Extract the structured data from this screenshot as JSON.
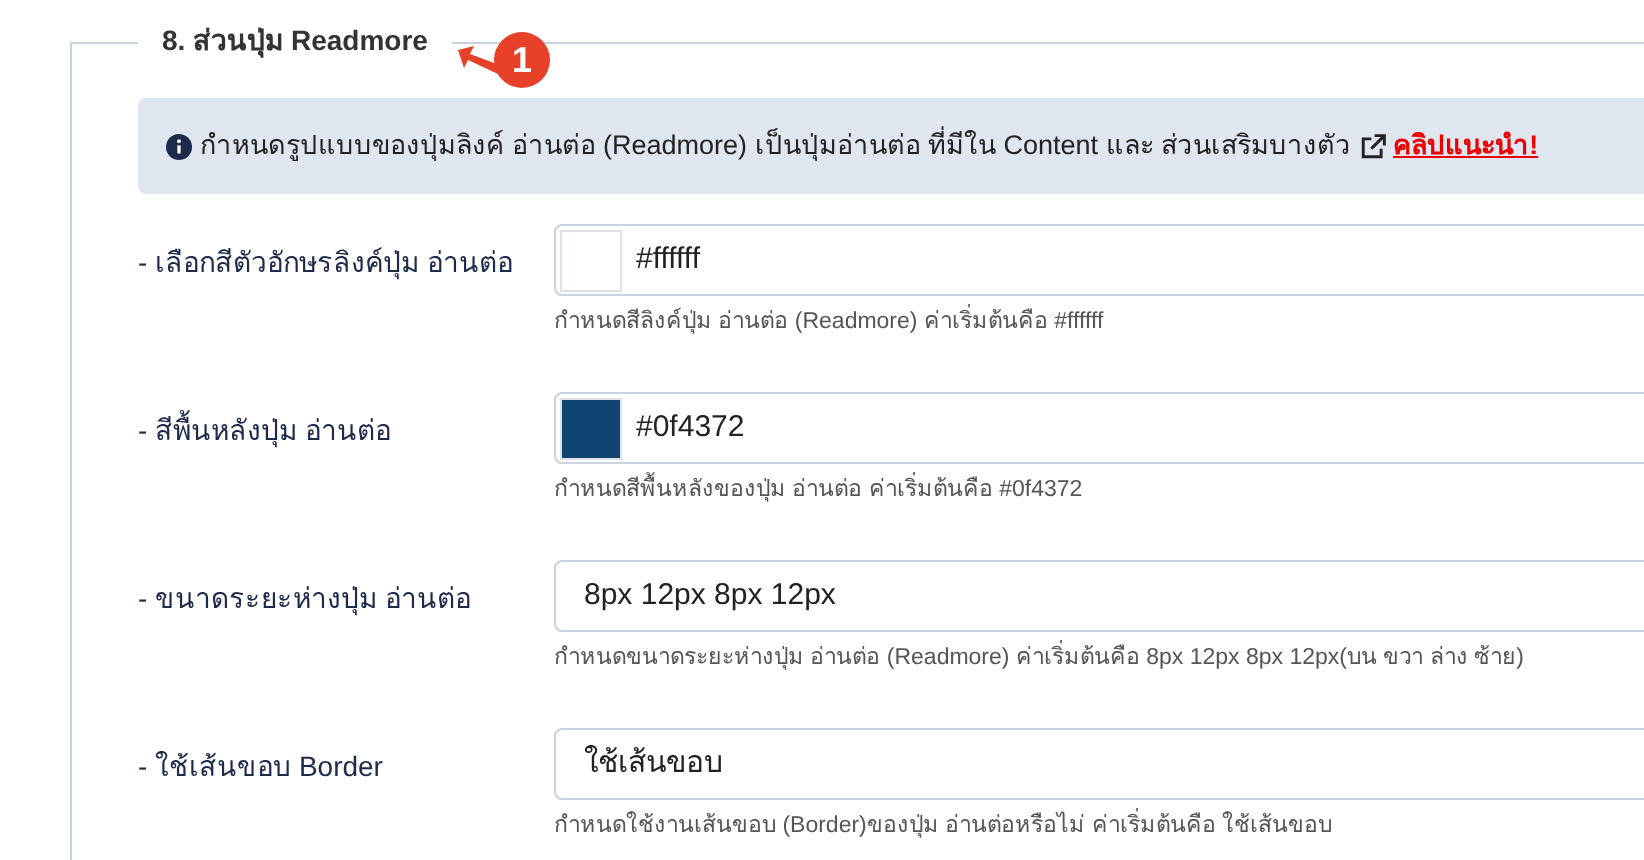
{
  "section": {
    "legend": "8. ส่วนปุ่ม Readmore",
    "annotation": "1"
  },
  "info": {
    "text": "กำหนดรูปแบบของปุ่มลิงค์ อ่านต่อ (Readmore) เป็นปุ่มอ่านต่อ ที่มีใน Content และ ส่วนเสริมบางตัว",
    "link": "คลิปแนะนำ!"
  },
  "fields": [
    {
      "kind": "color",
      "label": "- เลือกสีตัวอักษรลิงค์ปุ่ม อ่านต่อ",
      "value": "#ffffff",
      "color": "#ffffff",
      "help": "กำหนดสีลิงค์ปุ่ม อ่านต่อ (Readmore) ค่าเริ่มต้นคือ #ffffff"
    },
    {
      "kind": "color",
      "label": "- สีพื้นหลังปุ่ม อ่านต่อ",
      "value": "#0f4372",
      "color": "#0f4372",
      "help": "กำหนดสีพื้นหลังของปุ่ม อ่านต่อ ค่าเริ่มต้นคือ #0f4372"
    },
    {
      "kind": "text",
      "label": "- ขนาดระยะห่างปุ่ม อ่านต่อ",
      "value": "8px 12px 8px 12px",
      "help": "กำหนดขนาดระยะห่างปุ่ม อ่านต่อ (Readmore) ค่าเริ่มต้นคือ 8px 12px 8px 12px(บน ขวา ล่าง ซ้าย)"
    },
    {
      "kind": "text",
      "label": "- ใช้เส้นขอบ Border",
      "value": "ใช้เส้นขอบ",
      "help": "กำหนดใช้งานเส้นขอบ (Border)ของปุ่ม อ่านต่อหรือไม่ ค่าเริ่มต้นคือ ใช้เส้นขอบ"
    }
  ]
}
